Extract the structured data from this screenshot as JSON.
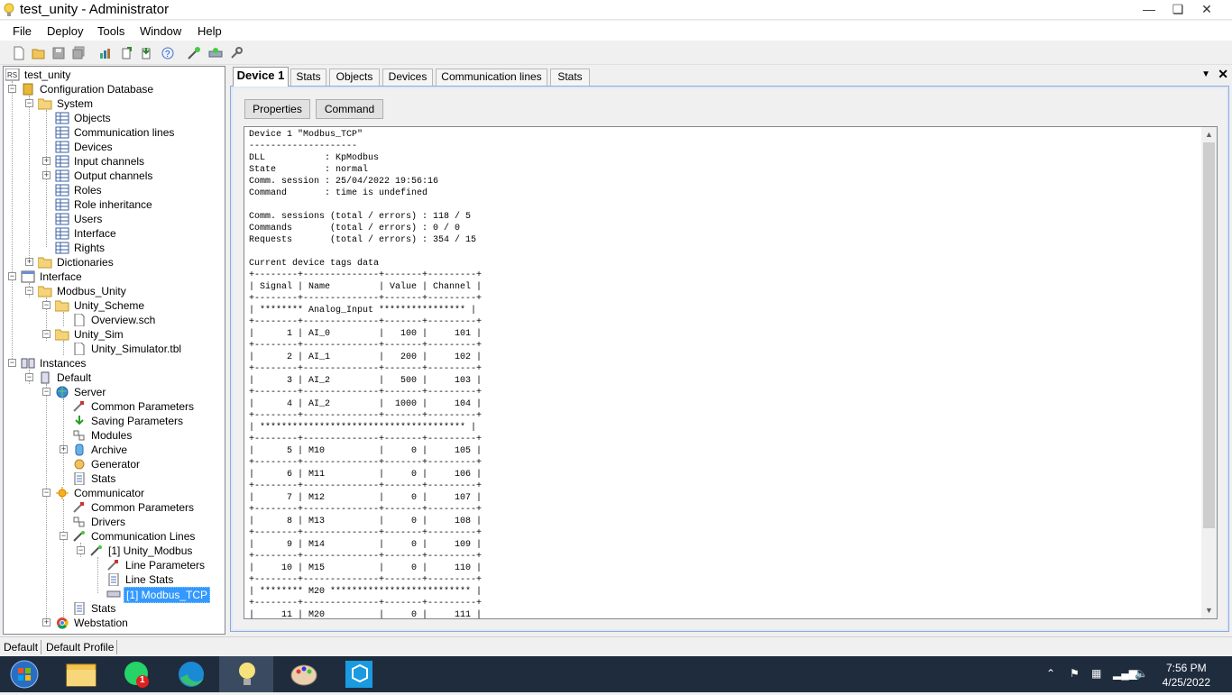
{
  "window": {
    "title": "test_unity - Administrator"
  },
  "menu": [
    "File",
    "Deploy",
    "Tools",
    "Window",
    "Help"
  ],
  "tree": {
    "root": "test_unity",
    "config_db": "Configuration Database",
    "system": "System",
    "system_items": [
      "Objects",
      "Communication lines",
      "Devices",
      "Input channels",
      "Output channels",
      "Roles",
      "Role inheritance",
      "Users",
      "Interface",
      "Rights"
    ],
    "dictionaries": "Dictionaries",
    "interface": "Interface",
    "modbus_unity": "Modbus_Unity",
    "unity_scheme": "Unity_Scheme",
    "overview": "Overview.sch",
    "unity_sim": "Unity_Sim",
    "unity_simulator": "Unity_Simulator.tbl",
    "instances": "Instances",
    "default": "Default",
    "server": "Server",
    "server_items": [
      "Common Parameters",
      "Saving Parameters",
      "Modules",
      "Archive",
      "Generator",
      "Stats"
    ],
    "communicator": "Communicator",
    "comm_items": [
      "Common Parameters",
      "Drivers",
      "Communication Lines"
    ],
    "line": "[1] Unity_Modbus",
    "line_items": [
      "Line Parameters",
      "Line Stats",
      "[1] Modbus_TCP"
    ],
    "comm_stats": "Stats",
    "webstation": "Webstation"
  },
  "tabs": [
    "Device 1",
    "Stats",
    "Objects",
    "Devices",
    "Communication lines",
    "Stats"
  ],
  "buttons": {
    "properties": "Properties",
    "command": "Command"
  },
  "device_text": "Device 1 \"Modbus_TCP\"\n--------------------\nDLL           : KpModbus\nState         : normal\nComm. session : 25/04/2022 19:56:16\nCommand       : time is undefined\n\nComm. sessions (total / errors) : 118 / 5\nCommands       (total / errors) : 0 / 0\nRequests       (total / errors) : 354 / 15\n\nCurrent device tags data\n+--------+--------------+-------+---------+\n| Signal | Name         | Value | Channel |\n+--------+--------------+-------+---------+\n| ******** Analog_Input **************** |\n+--------+--------------+-------+---------+\n|      1 | AI_0         |   100 |     101 |\n+--------+--------------+-------+---------+\n|      2 | AI_1         |   200 |     102 |\n+--------+--------------+-------+---------+\n|      3 | AI_2         |   500 |     103 |\n+--------+--------------+-------+---------+\n|      4 | AI_2         |  1000 |     104 |\n+--------+--------------+-------+---------+\n| ************************************** |\n+--------+--------------+-------+---------+\n|      5 | M10          |     0 |     105 |\n+--------+--------------+-------+---------+\n|      6 | M11          |     0 |     106 |\n+--------+--------------+-------+---------+\n|      7 | M12          |     0 |     107 |\n+--------+--------------+-------+---------+\n|      8 | M13          |     0 |     108 |\n+--------+--------------+-------+---------+\n|      9 | M14          |     0 |     109 |\n+--------+--------------+-------+---------+\n|     10 | M15          |     0 |     110 |\n+--------+--------------+-------+---------+\n| ******** M20 ************************** |\n+--------+--------------+-------+---------+\n|     11 | M20          |     0 |     111 |",
  "status": [
    "Default",
    "Default Profile"
  ],
  "taskbar": {
    "badge": "1",
    "time": "7:56 PM",
    "date": "4/25/2022"
  }
}
